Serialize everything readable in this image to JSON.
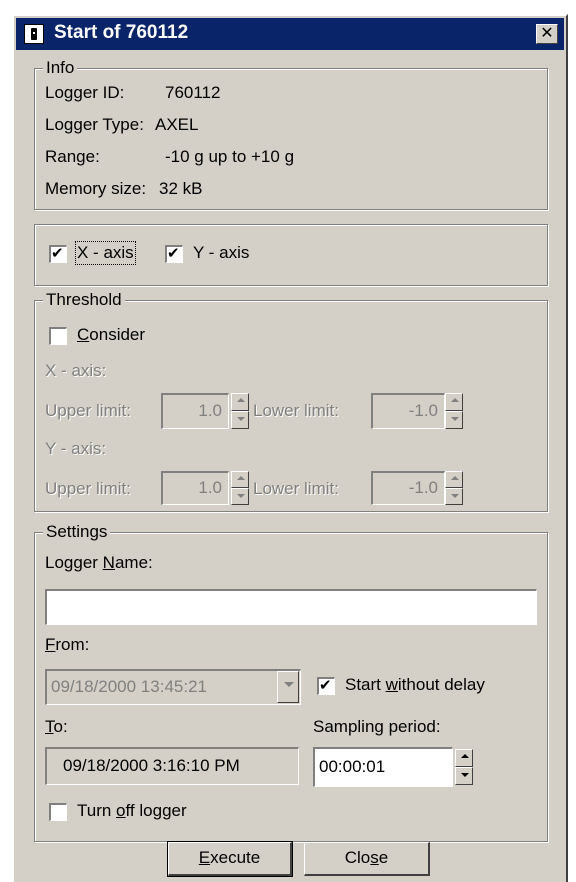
{
  "window": {
    "title": "Start of 760112",
    "close_glyph": "✕",
    "icon": "app-icon"
  },
  "info": {
    "legend": "Info",
    "logger_id_label": "Logger ID:",
    "logger_id_value": "760112",
    "logger_type_label": "Logger Type:",
    "logger_type_value": "AXEL",
    "range_label": "Range:",
    "range_value": "-10 g up to +10 g",
    "memory_label": "Memory size:",
    "memory_value": "32 kB"
  },
  "axes": {
    "x_axis": {
      "label": "X - axis",
      "checked": true
    },
    "y_axis": {
      "label": "Y - axis",
      "checked": true
    }
  },
  "threshold": {
    "legend": "Threshold",
    "consider": {
      "label_pre": "",
      "label_u": "C",
      "label_post": "onsider",
      "checked": false
    },
    "x_axis_label": "X - axis:",
    "y_axis_label": "Y - axis:",
    "upper_limit_label": "Upper limit:",
    "lower_limit_label": "Lower limit:",
    "x_upper_value": "1.0",
    "x_lower_value": "-1.0",
    "y_upper_value": "1.0",
    "y_lower_value": "-1.0"
  },
  "settings": {
    "legend": "Settings",
    "logger_name_label_pre": "Logger ",
    "logger_name_label_u": "N",
    "logger_name_label_post": "ame:",
    "logger_name_value": "",
    "from_label_u": "F",
    "from_label_post": "rom:",
    "from_value": "09/18/2000 13:45:21",
    "start_without_delay": {
      "label_pre": "Start ",
      "label_u": "w",
      "label_post": "ithout delay",
      "checked": true
    },
    "to_label_u": "T",
    "to_label_post": "o:",
    "to_value": "09/18/2000 3:16:10 PM",
    "sampling_label": "Sampling period:",
    "sampling_value": "00:00:01",
    "turn_off": {
      "label_pre": "Turn ",
      "label_u": "o",
      "label_post": "ff logger",
      "checked": false
    }
  },
  "buttons": {
    "execute": {
      "pre": "",
      "u": "E",
      "post": "xecute"
    },
    "close": {
      "pre": "Clo",
      "u": "s",
      "post": "e"
    }
  }
}
